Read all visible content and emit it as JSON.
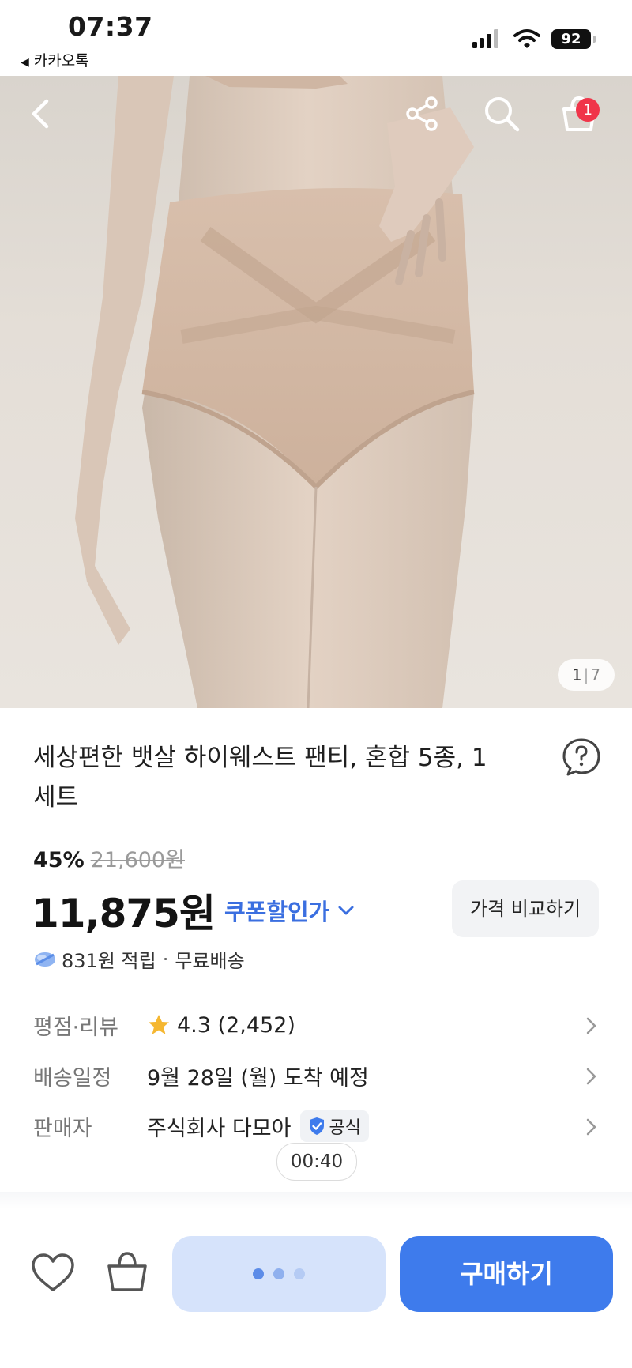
{
  "status_bar": {
    "time": "07:37",
    "back_app": "카카오톡",
    "battery": "92"
  },
  "hero": {
    "cart_count": "1",
    "page_current": "1",
    "page_total": "7",
    "icons": [
      "back-icon",
      "share-icon",
      "search-icon",
      "cart-icon"
    ]
  },
  "product": {
    "title": "세상편한 뱃살 하이웨스트 팬티, 혼합 5종, 1 세트",
    "discount_rate": "45%",
    "original_price": "21,600원",
    "sale_price": "11,875원",
    "coupon_label": "쿠폰할인가",
    "compare_label": "가격 비교하기",
    "reward_text": "831원 적립",
    "shipping_text": "무료배송"
  },
  "info": {
    "rating_label": "평점·리뷰",
    "rating_value": "4.3 (2,452)",
    "delivery_label": "배송일정",
    "delivery_value": "9월 28일 (월) 도착 예정",
    "seller_label": "판매자",
    "seller_value": "주식회사 다모아",
    "official_label": "공식"
  },
  "timer": "00:40",
  "bottom_bar": {
    "buy_label": "구매하기"
  },
  "colors": {
    "accent": "#3e7bec",
    "coupon": "#3b6fe0",
    "badge": "#f0354a",
    "star": "#f5b731",
    "loading_bg": "#d6e3fb"
  }
}
